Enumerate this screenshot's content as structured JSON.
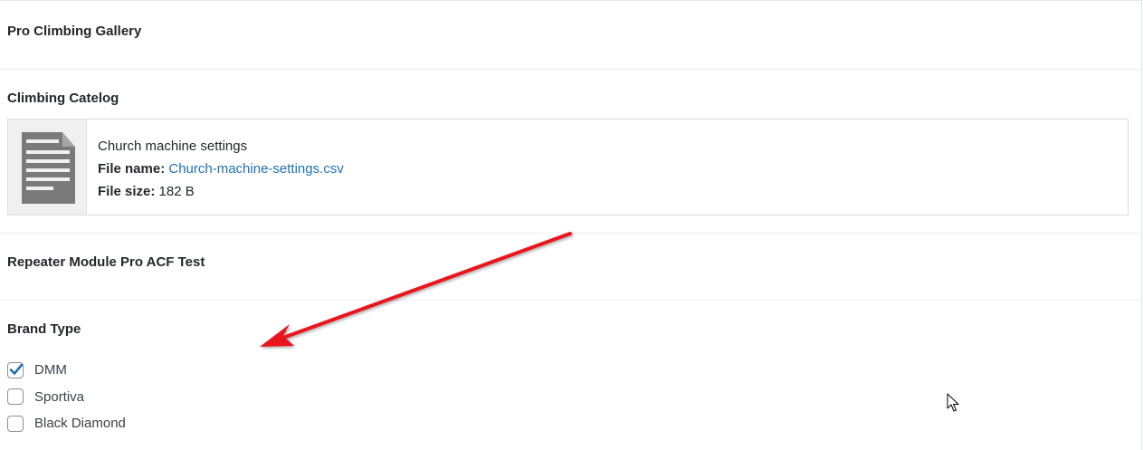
{
  "fields": {
    "gallery_label": "Pro Climbing Gallery",
    "catalog_label": "Climbing Catelog",
    "repeater_label": "Repeater Module Pro ACF Test",
    "brand_label": "Brand Type"
  },
  "file": {
    "title": "Church machine settings",
    "name_key": "File name:",
    "name_value": "Church-machine-settings.csv",
    "size_key": "File size:",
    "size_value": "182 B",
    "icon": "document-icon"
  },
  "brands": [
    {
      "label": "DMM",
      "checked": true
    },
    {
      "label": "Sportiva",
      "checked": false
    },
    {
      "label": "Black Diamond",
      "checked": false
    }
  ],
  "colors": {
    "accent": "#2271b1",
    "annotation_arrow": "#e8161b"
  }
}
